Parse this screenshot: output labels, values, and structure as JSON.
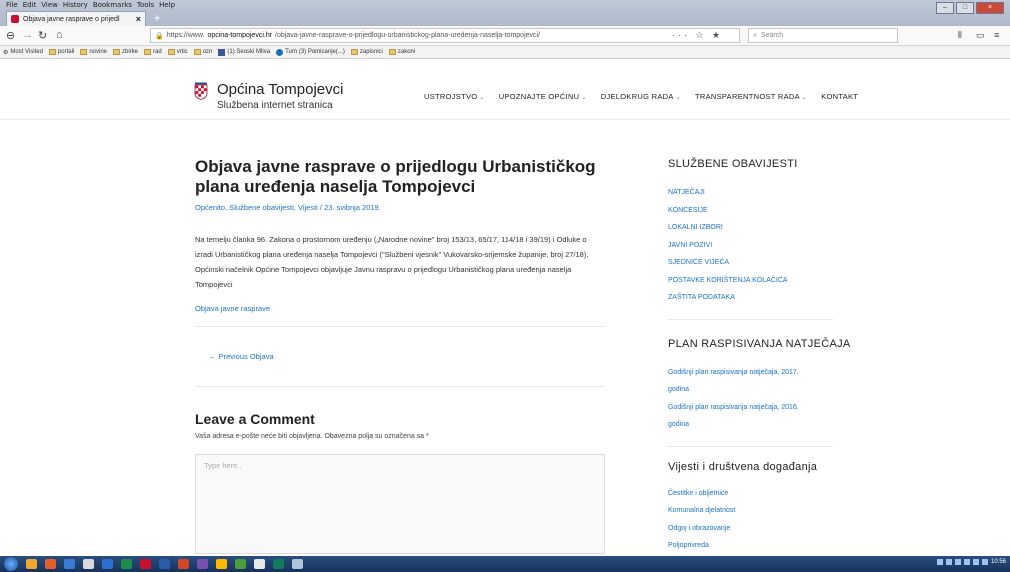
{
  "browser": {
    "menu": [
      "File",
      "Edit",
      "View",
      "History",
      "Bookmarks",
      "Tools",
      "Help"
    ],
    "tab_title": "Objava javne rasprave o prijedl",
    "url_prefix": "https://www.",
    "url_domain": "opcina-tompojevci.hr",
    "url_path": "/objava-javne-rasprave-o-prijedlogu-urbanistickog-plana-uredenja-naselja-tompojevci/",
    "page_actions": "··· ☆ ★",
    "search_placeholder": "Search",
    "bookmarks": [
      "Most Visited",
      "portali",
      "novine",
      "zbirke",
      "rad",
      "vrtic",
      "ozn",
      "(1) Seoski Mliva",
      "Turn (3) Pomicanje(...)",
      "zapisnici",
      "zakoni"
    ]
  },
  "site": {
    "name": "Općina Tompojevci",
    "subtitle": "Službena internet stranica",
    "nav": [
      {
        "label": "USTROJSTVO",
        "caret": "⌄"
      },
      {
        "label": "UPOZNAJTE OPĆINU",
        "caret": "⌄"
      },
      {
        "label": "DJELOKRUG RADA",
        "caret": "⌄"
      },
      {
        "label": "TRANSPARENTNOST RADA",
        "caret": "⌄"
      },
      {
        "label": "KONTAKT",
        "caret": ""
      }
    ]
  },
  "post": {
    "title": "Objava javne rasprave o prijedlogu Urbanističkog plana uređenja naselja Tompojevci",
    "meta": "Općenito, Službene obavijesti, Vijesti / 23. svibnja 2019.",
    "body": "Na temelju članka 96. Zakona o prostornom uređenju („Narodne novine\" broj 153/13, 65/17, 114/18 i 39/19) i Odluke o izradi Urbanističkog plana uređenja naselja Tompojevci (\"Službeni vjesnik\" Vukovarsko-srijemske županije, broj 27/18), Općinski načelnik Općine Tompojevci objavljuje Javnu raspravu o prijedlogu Urbanističkog plana uređenja naselja Tompojevci",
    "link": "Objava javne rasprave",
    "prev": "← Previous Objava"
  },
  "comment": {
    "title": "Leave a Comment",
    "note": "Vaša adresa e-pošte neće biti objavljena. Obavezna polja su označena sa *",
    "placeholder": "Type here.."
  },
  "sidebar": {
    "w1_title": "SLUŽBENE OBAVIJESTI",
    "w1_items": [
      "NATJEČAJI",
      "KONCESIJE",
      "LOKALNI IZBORI",
      "JAVNI POZIVI",
      "SJEDNICE VIJEĆA",
      "POSTAVKE KORIŠTENJA KOLAČIĆA",
      "ZAŠTITA PODATAKA"
    ],
    "w2_title": "PLAN RASPISIVANJA NATJEČAJA",
    "w2_items": [
      "Godišnji plan raspisivanja natječaja, 2017. godina",
      "Godišnji plan raspisivanja natječaja, 2016. godina"
    ],
    "w3_title": "Vijesti i društvena događanja",
    "w3_items": [
      "Čestitke i obljetnice",
      "Komunalna djelatnost",
      "Odgoj i obrazovanje",
      "Poljoprivreda"
    ]
  },
  "tray": {
    "time": "10:56"
  }
}
